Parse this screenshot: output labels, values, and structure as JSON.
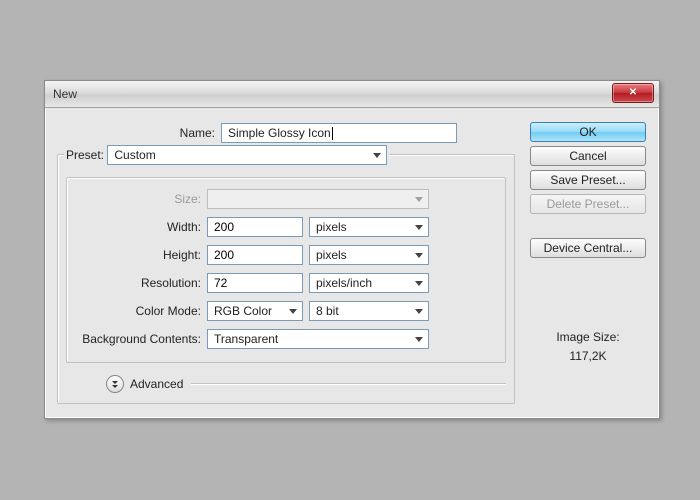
{
  "title": "New",
  "buttons": {
    "ok": "OK",
    "cancel": "Cancel",
    "save_preset": "Save Preset...",
    "delete_preset": "Delete Preset...",
    "device_central": "Device Central..."
  },
  "labels": {
    "name": "Name:",
    "preset": "Preset:",
    "size": "Size:",
    "width": "Width:",
    "height": "Height:",
    "resolution": "Resolution:",
    "color_mode": "Color Mode:",
    "background_contents": "Background Contents:",
    "advanced": "Advanced",
    "image_size": "Image Size:"
  },
  "values": {
    "name": "Simple Glossy Icon",
    "preset": "Custom",
    "size": "",
    "width": "200",
    "width_unit": "pixels",
    "height": "200",
    "height_unit": "pixels",
    "resolution": "72",
    "resolution_unit": "pixels/inch",
    "color_mode": "RGB Color",
    "color_depth": "8 bit",
    "background_contents": "Transparent",
    "image_size_value": "117,2K"
  }
}
